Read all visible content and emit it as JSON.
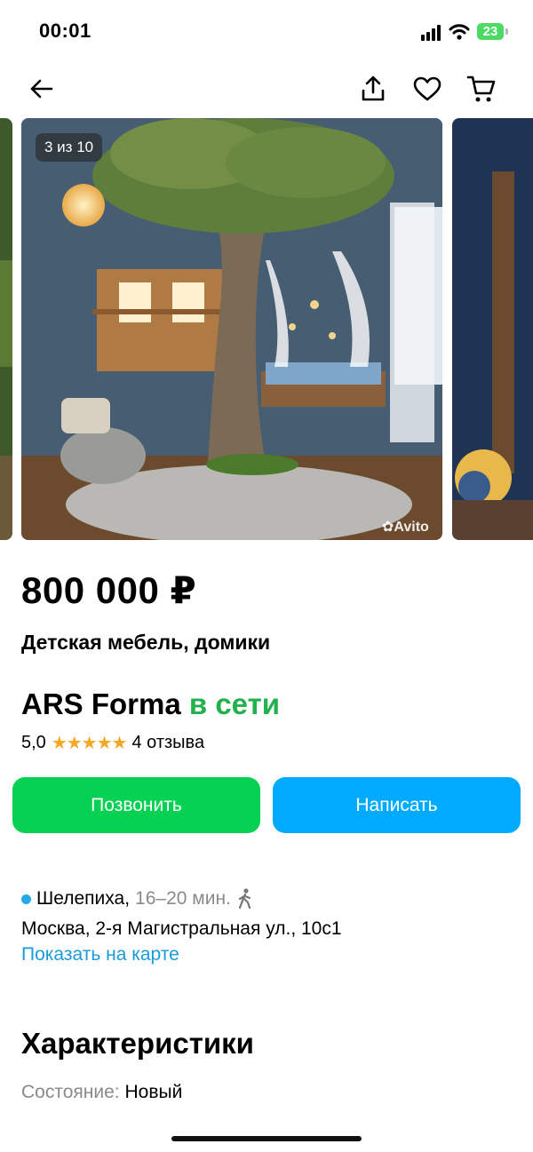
{
  "status_bar": {
    "time": "00:01",
    "battery": "23"
  },
  "gallery": {
    "counter": "3 из 10",
    "watermark": "Avito"
  },
  "listing": {
    "price": "800 000 ₽",
    "title": "Детская мебель, домики"
  },
  "seller": {
    "name": "ARS Forma",
    "status": "в сети",
    "rating": "5,0",
    "stars": "★★★★★",
    "reviews": "4 отзыва"
  },
  "actions": {
    "call": "Позвонить",
    "write": "Написать"
  },
  "location": {
    "metro": "Шелепиха,",
    "time": "16–20 мин.",
    "address": "Москва, 2-я Магистральная ул., 10с1",
    "map_link": "Показать на карте"
  },
  "characteristics": {
    "heading": "Характеристики",
    "condition_label": "Состояние:",
    "condition_value": "Новый"
  },
  "colors": {
    "green": "#06d152",
    "blue": "#00aaff",
    "online": "#22b14c",
    "star": "#f5a623"
  }
}
